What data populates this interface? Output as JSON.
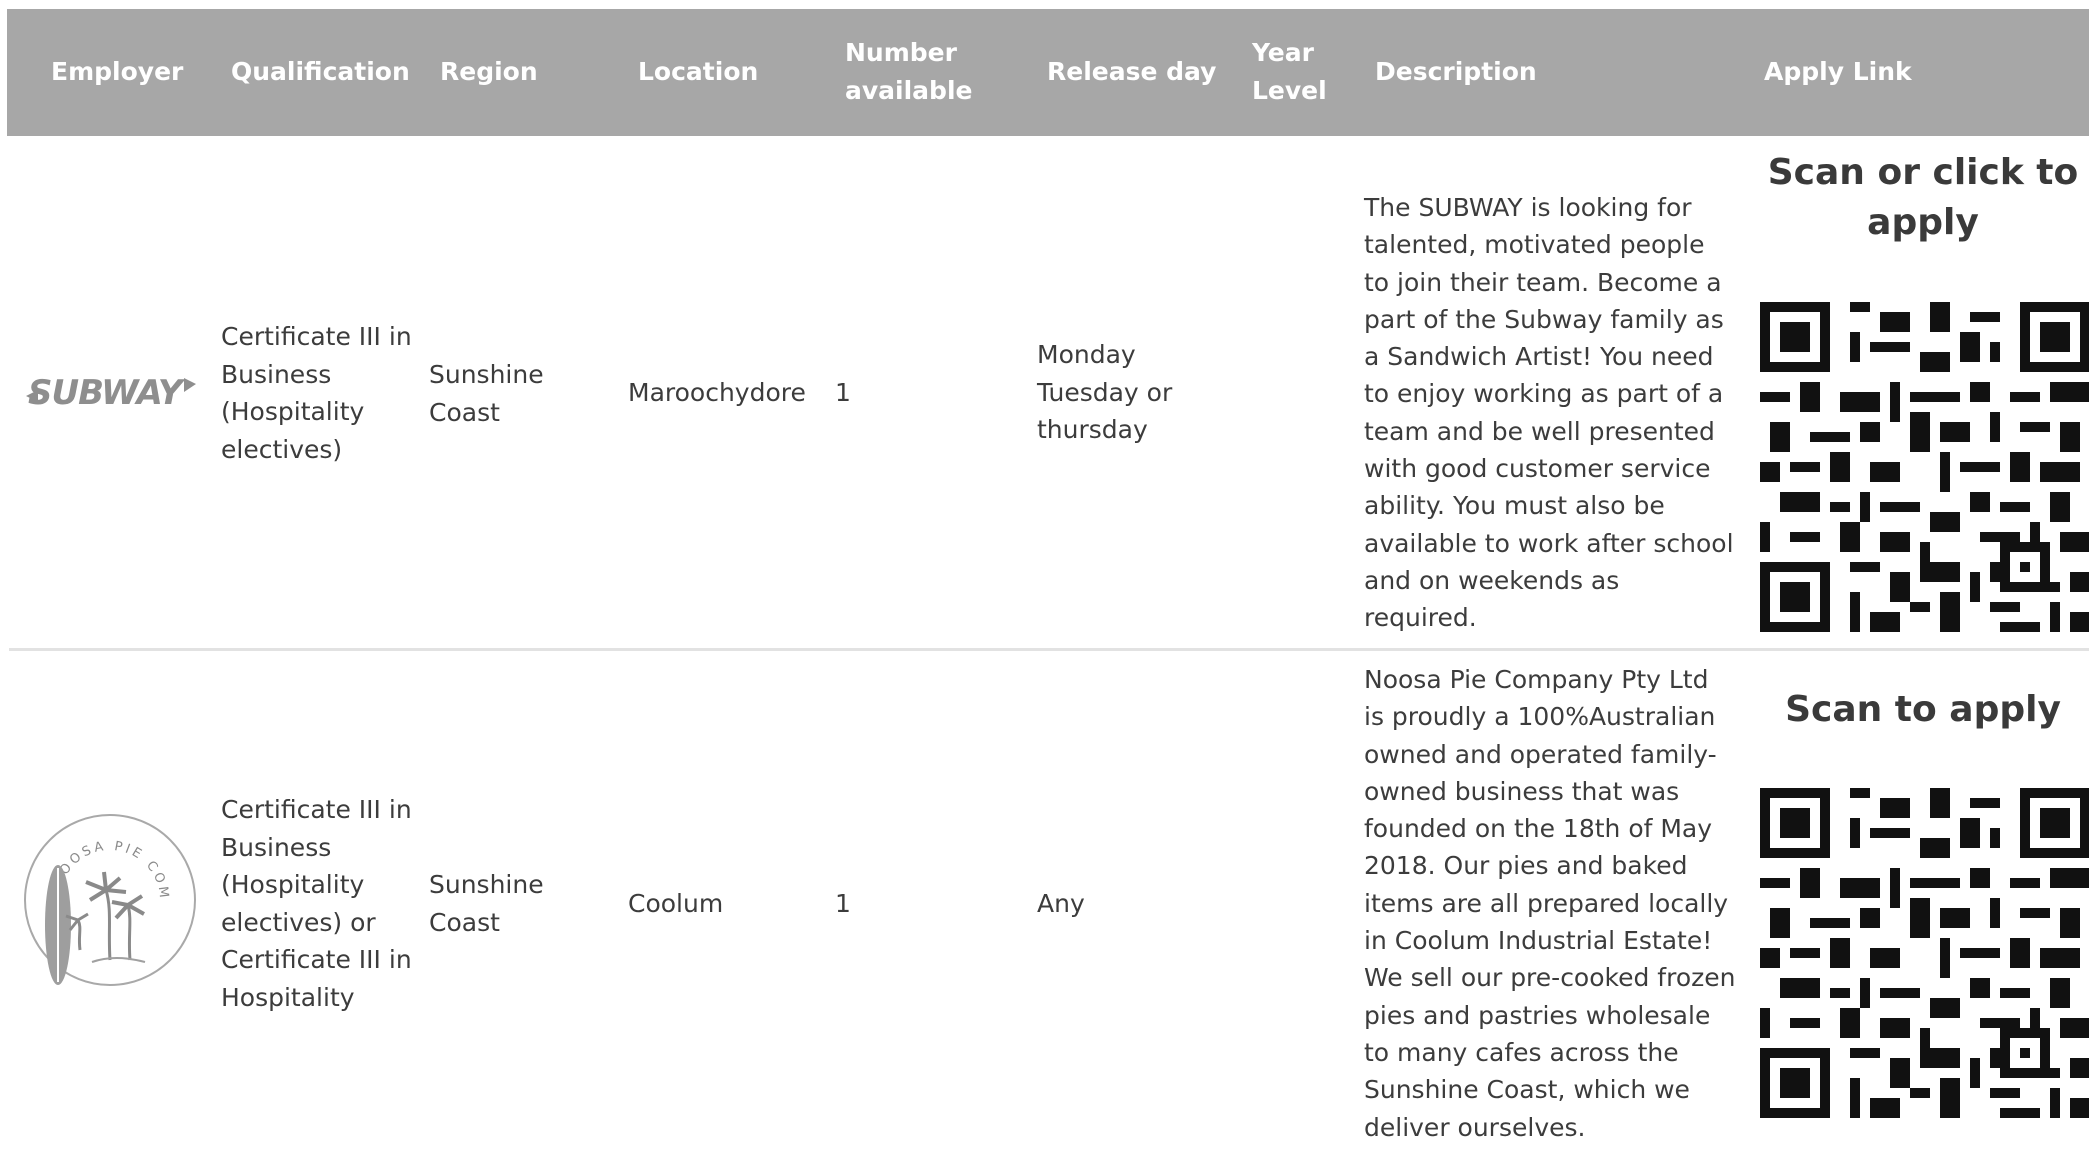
{
  "table": {
    "headers": {
      "employer": "Employer",
      "qualification": "Qualification",
      "region": "Region",
      "location": "Location",
      "number_available": "Number\navailable",
      "release_day": "Release day",
      "year_level": "Year\nLevel",
      "description": "Description",
      "apply_link": "Apply Link"
    },
    "rows": [
      {
        "employer_logo_text": "SUBWAY",
        "qualification": "Certificate III in\nBusiness\n(Hospitality\nelectives)",
        "region": "Sunshine\nCoast",
        "location": "Maroochydore",
        "number_available": "1",
        "release_day": "Monday\nTuesday or\nthursday",
        "year_level": "",
        "description": "The SUBWAY is looking for talented, motivated people to join their team. Become a part of the Subway family as a Sandwich Artist! You need to enjoy working as part of a team and be well presented with good customer service ability. You must also be available to work after school and on weekends as required.",
        "apply_title": "Scan or click to\napply"
      },
      {
        "employer_logo_text": "NOOSA PIE COMPANY",
        "qualification": "Certificate III in\nBusiness\n(Hospitality\nelectives) or\nCertificate III in\nHospitality",
        "region": "Sunshine\nCoast",
        "location": "Coolum",
        "number_available": "1",
        "release_day": "Any",
        "year_level": "",
        "description": "Noosa Pie Company Pty Ltd is proudly a 100%Australian owned and operated family-owned business that was founded on the 18th of May 2018. Our pies and baked items are all prepared locally in Coolum Industrial Estate! We sell our pre-cooked frozen pies and pastries wholesale to many cafes across the Sunshine Coast, which we deliver ourselves.",
        "apply_title": "Scan to apply"
      }
    ]
  },
  "colors": {
    "header_bg": "#a7a7a7",
    "header_text": "#ffffff",
    "body_text": "#3c3c3c",
    "divider": "#e2e2e2"
  }
}
